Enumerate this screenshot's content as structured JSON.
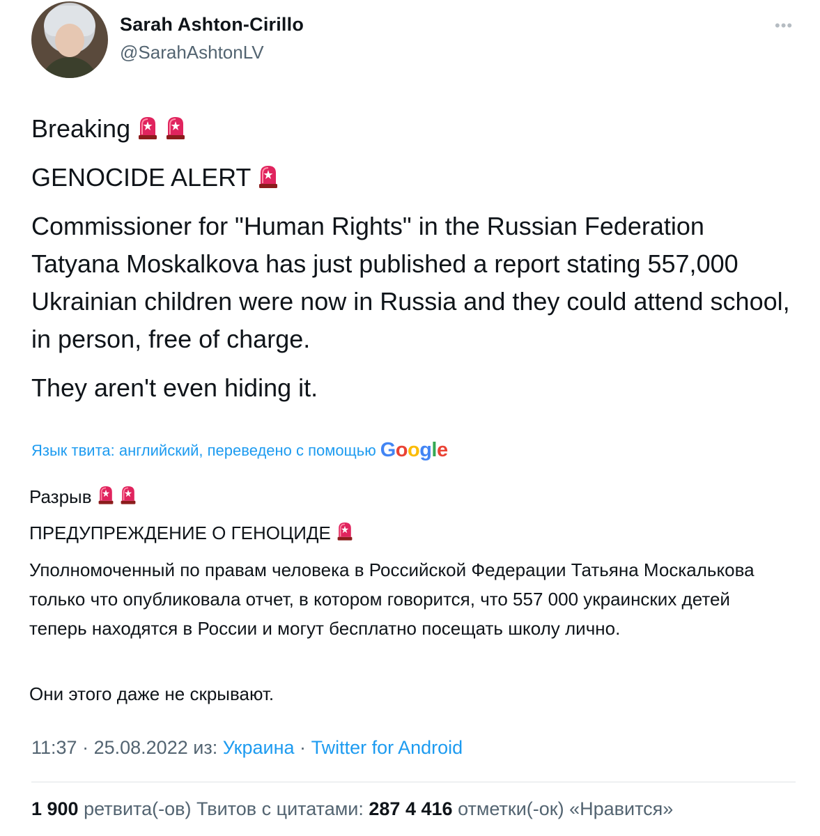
{
  "author": {
    "display_name": "Sarah Ashton-Cirillo",
    "handle": "@SarahAshtonLV"
  },
  "more_icon": "more-horizontal-icon",
  "tweet": {
    "line1": "Breaking",
    "line2": "GENOCIDE ALERT",
    "paragraph": "Commissioner for \"Human Rights\" in the Russian Federation Tatyana Moskalkova has just published a report stating 557,000 Ukrainian children were now in Russia and they could attend school, in person, free of charge.",
    "last": "They aren't even hiding it.",
    "emoji_icon": "police-car-light-icon"
  },
  "translation": {
    "note": "Язык твита: английский, переведено с помощью",
    "provider": "Google",
    "line1": "Разрыв",
    "line2": "ПРЕДУПРЕЖДЕНИЕ О ГЕНОЦИДЕ",
    "paragraph": "Уполномоченный по правам человека в Российской Федерации Татьяна Москалькова только что опубликовала отчет, в котором говорится, что 557 000 украинских детей теперь находятся в России и могут бесплатно посещать школу лично.",
    "last": "Они этого даже не скрывают."
  },
  "meta": {
    "time": "11:37",
    "sep1": "·",
    "date": "25.08.2022",
    "from": "из:",
    "location": "Украина",
    "sep2": "·",
    "client": "Twitter for Android"
  },
  "stats": {
    "retweets_count": "1 900",
    "retweets_label": "ретвита(-ов)",
    "quotes_label": "Твитов с цитатами:",
    "quotes_count": "287",
    "likes_count": "4 416",
    "likes_label": "отметки(-ок) «Нравится»"
  },
  "colors": {
    "link": "#1d9bf0",
    "muted": "#536471",
    "text": "#0f1419"
  }
}
